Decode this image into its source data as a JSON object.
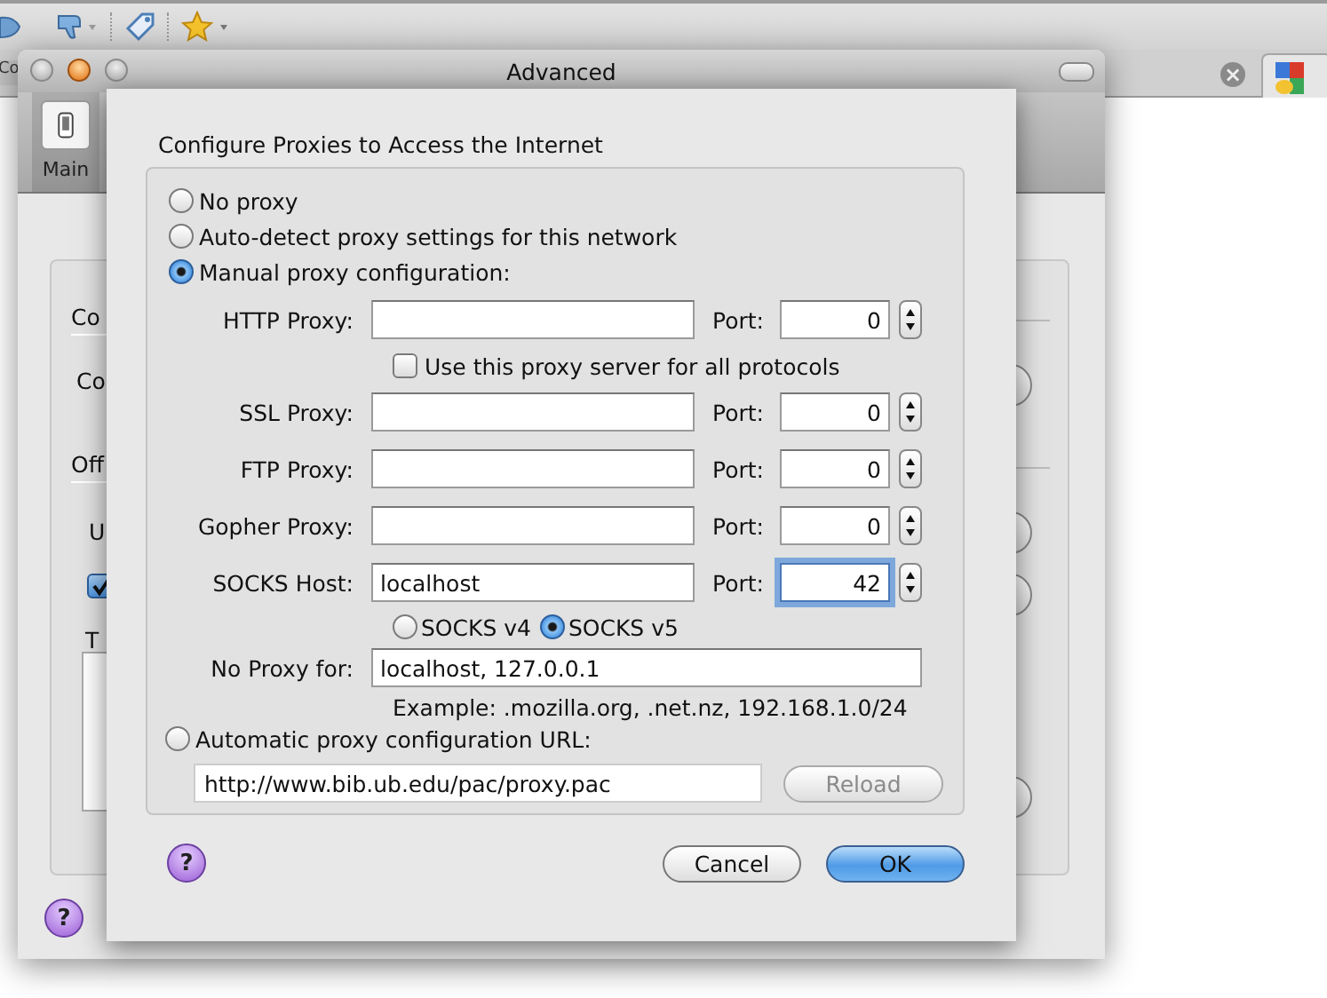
{
  "browser": {
    "tab_fragment": "Co",
    "tab_close": "×"
  },
  "prefs_window": {
    "title": "Advanced",
    "toolbar_items": [
      {
        "label": "Main",
        "selected": true
      }
    ],
    "fragments": [
      {
        "kind": "heading",
        "text": "Co"
      },
      {
        "kind": "label",
        "text": "Co"
      },
      {
        "kind": "heading",
        "text": "Off"
      },
      {
        "kind": "label",
        "text": "U"
      },
      {
        "kind": "checkbox",
        "checked": true
      },
      {
        "kind": "label",
        "text": "T"
      },
      {
        "kind": "textarea"
      }
    ],
    "help": "?"
  },
  "sheet": {
    "heading": "Configure Proxies to Access the Internet",
    "modes": [
      {
        "label": "No proxy",
        "selected": false
      },
      {
        "label": "Auto-detect proxy settings for this network",
        "selected": false
      },
      {
        "label": "Manual proxy configuration:",
        "selected": true
      },
      {
        "label": "Automatic proxy configuration URL:",
        "selected": false
      }
    ],
    "proxies": [
      {
        "label": "HTTP Proxy:",
        "port_label": "Port:",
        "port": "0",
        "focused": false
      },
      {
        "label": "SSL Proxy:",
        "port_label": "Port:",
        "port": "0",
        "focused": false
      },
      {
        "label": "FTP Proxy:",
        "port_label": "Port:",
        "port": "0",
        "focused": false
      },
      {
        "label": "Gopher Proxy:",
        "port_label": "Port:",
        "port": "0",
        "focused": false
      },
      {
        "label": "SOCKS Host:",
        "value": "localhost",
        "port_label": "Port:",
        "port": "42",
        "focused": true
      }
    ],
    "share_all": {
      "label": "Use this proxy server for all protocols",
      "checked": false
    },
    "socks_versions": [
      {
        "label": "SOCKS v4",
        "selected": false
      },
      {
        "label": "SOCKS v5",
        "selected": true
      }
    ],
    "no_proxy": {
      "label": "No Proxy for:",
      "value": "localhost, 127.0.0.1"
    },
    "example": "Example: .mozilla.org, .net.nz, 192.168.1.0/24",
    "auto_url": {
      "value": "http://www.bib.ub.edu/pac/proxy.pac"
    },
    "reload": {
      "label": "Reload",
      "disabled": true
    },
    "help": "?",
    "buttons": [
      {
        "label": "Cancel",
        "default": false
      },
      {
        "label": "OK",
        "default": true
      }
    ]
  }
}
